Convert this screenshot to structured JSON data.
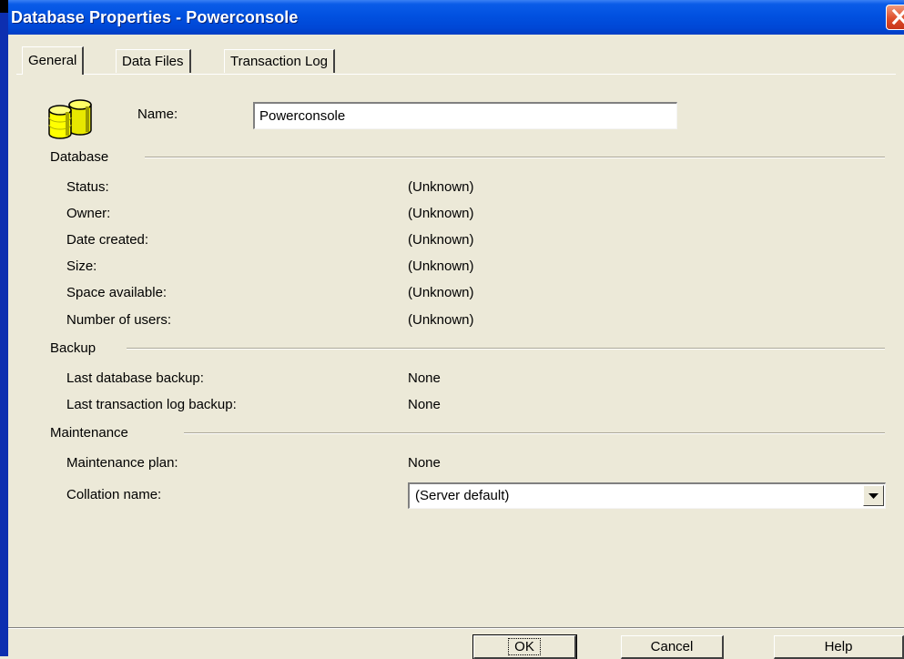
{
  "window": {
    "title": "Database Properties - Powerconsole"
  },
  "tabs": [
    {
      "label": "General"
    },
    {
      "label": "Data Files"
    },
    {
      "label": "Transaction Log"
    }
  ],
  "general": {
    "name_label": "Name:",
    "name_value": "Powerconsole",
    "database": {
      "heading": "Database",
      "rows": [
        {
          "label": "Status:",
          "value": "(Unknown)"
        },
        {
          "label": "Owner:",
          "value": "(Unknown)"
        },
        {
          "label": "Date created:",
          "value": "(Unknown)"
        },
        {
          "label": "Size:",
          "value": "(Unknown)"
        },
        {
          "label": "Space available:",
          "value": "(Unknown)"
        },
        {
          "label": "Number of users:",
          "value": "(Unknown)"
        }
      ]
    },
    "backup": {
      "heading": "Backup",
      "rows": [
        {
          "label": "Last database backup:",
          "value": "None"
        },
        {
          "label": "Last transaction log backup:",
          "value": "None"
        }
      ]
    },
    "maintenance": {
      "heading": "Maintenance",
      "plan_label": "Maintenance plan:",
      "plan_value": "None",
      "collation_label": "Collation name:",
      "collation_value": "(Server default)"
    }
  },
  "buttons": {
    "ok": "OK",
    "cancel": "Cancel",
    "help": "Help"
  },
  "colors": {
    "titlebar": "#0151e0",
    "dialog_bg": "#ece9d8",
    "close": "#de4e2b"
  },
  "icons": {
    "database": "database-icon",
    "close": "close-icon",
    "dropdown": "chevron-down-icon"
  }
}
